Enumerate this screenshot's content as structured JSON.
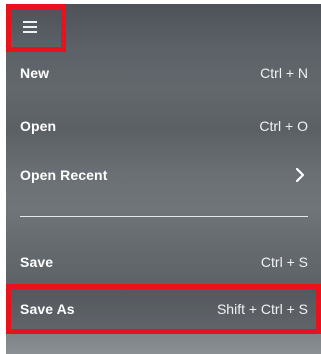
{
  "menu": {
    "items": [
      {
        "label": "New",
        "shortcut": "Ctrl + N"
      },
      {
        "label": "Open",
        "shortcut": "Ctrl + O"
      },
      {
        "label": "Open Recent",
        "shortcut": ""
      },
      {
        "label": "Save",
        "shortcut": "Ctrl + S"
      },
      {
        "label": "Save As",
        "shortcut": "Shift + Ctrl + S"
      }
    ]
  },
  "colors": {
    "highlight_border": "#e8121c",
    "text": "#ffffff",
    "divider": "#e4e6e8"
  },
  "icons": {
    "menu_toggle": "hamburger-icon",
    "submenu": "chevron-right-icon"
  }
}
